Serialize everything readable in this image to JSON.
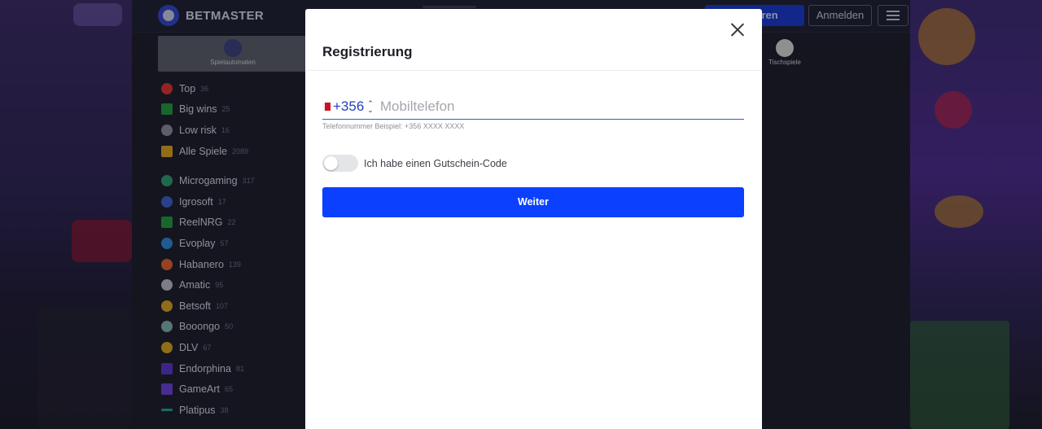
{
  "header": {
    "logo_text": "BETMASTER",
    "register_label": "Registrieren",
    "register_visible_text": "strieren",
    "login_label": "Anmelden"
  },
  "categories": [
    {
      "label": "Spielautomaten",
      "icon": "cherry-icon",
      "active": true
    },
    {
      "label": "Tischspiele",
      "icon": "cards-icon",
      "active": false
    }
  ],
  "sidebar": {
    "group1": [
      {
        "label": "Top",
        "count": "36",
        "icon": "fire-icon",
        "color": "#e0322c"
      },
      {
        "label": "Big wins",
        "count": "25",
        "icon": "money-icon",
        "color": "#1f9a3a"
      },
      {
        "label": "Low risk",
        "count": "16",
        "icon": "shield-icon",
        "color": "#8a8d99"
      },
      {
        "label": "Alle Spiele",
        "count": "2089",
        "icon": "cards-icon",
        "color": "#d9a51c"
      }
    ],
    "group2": [
      {
        "label": "Microgaming",
        "count": "317",
        "icon": "microgaming-icon",
        "color": "#2f9a6d"
      },
      {
        "label": "Igrosoft",
        "count": "17",
        "icon": "igrosoft-icon",
        "color": "#3a62c9"
      },
      {
        "label": "ReelNRG",
        "count": "22",
        "icon": "reelnrg-icon",
        "color": "#1f9a3a"
      },
      {
        "label": "Evoplay",
        "count": "57",
        "icon": "evoplay-icon",
        "color": "#2b86d6"
      },
      {
        "label": "Habanero",
        "count": "139",
        "icon": "habanero-icon",
        "color": "#e0622a"
      },
      {
        "label": "Amatic",
        "count": "95",
        "icon": "amatic-icon",
        "color": "#b9bcc6"
      },
      {
        "label": "Betsoft",
        "count": "107",
        "icon": "betsoft-icon",
        "color": "#d9a51c"
      },
      {
        "label": "Booongo",
        "count": "50",
        "icon": "booongo-icon",
        "color": "#7fb3a8"
      },
      {
        "label": "DLV",
        "count": "67",
        "icon": "dlv-icon",
        "color": "#d9a51c"
      },
      {
        "label": "Endorphina",
        "count": "81",
        "icon": "endorphina-icon",
        "color": "#5a34c9"
      },
      {
        "label": "GameArt",
        "count": "65",
        "icon": "gameart-icon",
        "color": "#6b3fd6"
      },
      {
        "label": "Platipus",
        "count": "38",
        "icon": "platipus-icon",
        "color": "#1fa38a"
      }
    ]
  },
  "modal": {
    "title": "Registrierung",
    "close_icon": "close-icon",
    "country_flag": "malta-flag-icon",
    "dial_code": "+356",
    "phone_placeholder": "Mobiltelefon",
    "phone_value": "",
    "phone_hint": "Telefonnummer Beispiel: +356 XXXX XXXX",
    "coupon_toggle_label": "Ich habe einen Gutschein-Code",
    "coupon_toggle_on": false,
    "submit_label": "Weiter",
    "submit_color": "#0b40ff"
  }
}
